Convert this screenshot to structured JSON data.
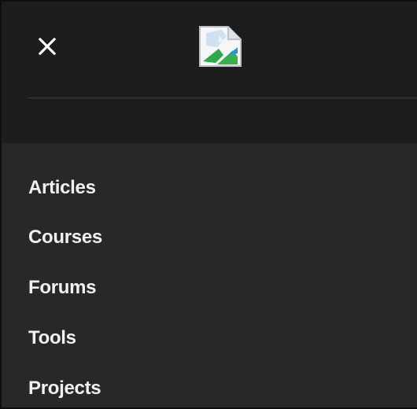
{
  "header": {
    "close_icon": "close-icon",
    "logo_icon": "broken-image-icon",
    "background_color": "#1d1d1d"
  },
  "menu": {
    "background_color": "#282828",
    "text_color": "#f2f2f2",
    "items": [
      {
        "label": "Articles"
      },
      {
        "label": "Courses"
      },
      {
        "label": "Forums"
      },
      {
        "label": "Tools"
      },
      {
        "label": "Projects"
      }
    ]
  }
}
